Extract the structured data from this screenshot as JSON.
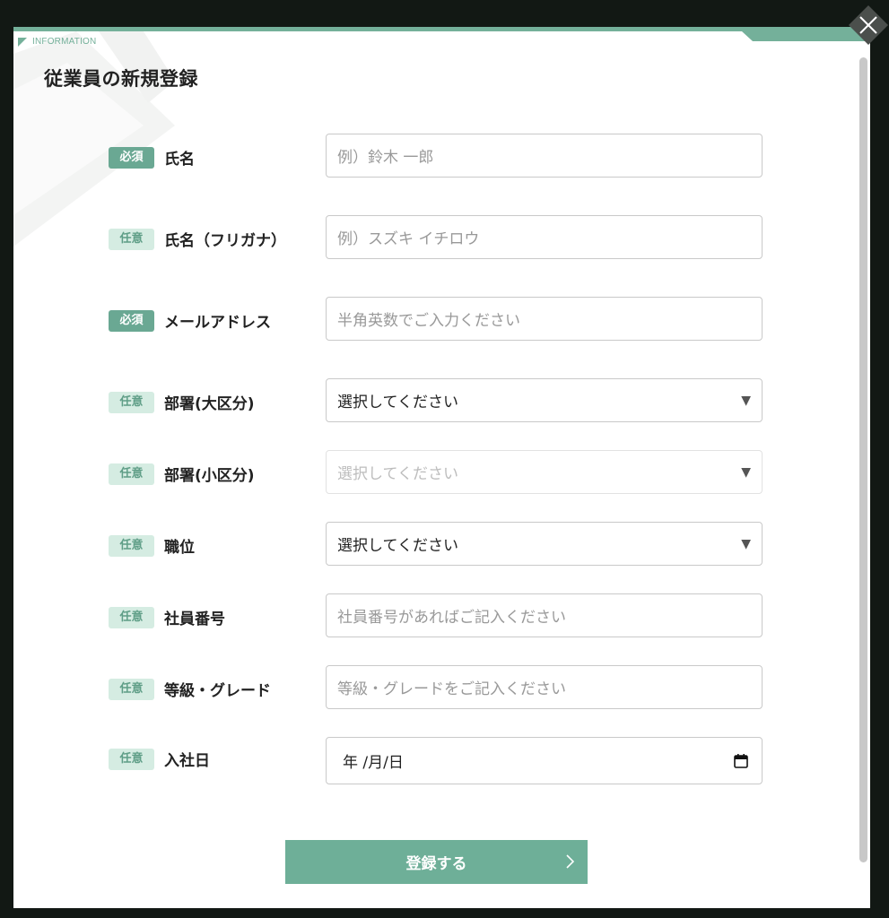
{
  "modal": {
    "info_label": "INFORMATION",
    "title": "従業員の新規登録",
    "submit_label": "登録する"
  },
  "badges": {
    "required": "必須",
    "optional": "任意"
  },
  "fields": [
    {
      "label": "氏名",
      "badge": "必須",
      "type": "text",
      "placeholder": "例）鈴木 一郎"
    },
    {
      "label": "氏名（フリガナ）",
      "badge": "任意",
      "type": "text",
      "placeholder": "例）スズキ イチロウ"
    },
    {
      "label": "メールアドレス",
      "badge": "必須",
      "type": "text",
      "placeholder": "半角英数でご入力ください"
    },
    {
      "label": "部署(大区分)",
      "badge": "任意",
      "type": "select",
      "value": "選択してください"
    },
    {
      "label": "部署(小区分)",
      "badge": "任意",
      "type": "select",
      "value": "選択してください",
      "disabled": true
    },
    {
      "label": "職位",
      "badge": "任意",
      "type": "select",
      "value": "選択してください"
    },
    {
      "label": "社員番号",
      "badge": "任意",
      "type": "text",
      "placeholder": "社員番号があればご記入ください"
    },
    {
      "label": "等級・グレード",
      "badge": "任意",
      "type": "text",
      "placeholder": "等級・グレードをご記入ください"
    },
    {
      "label": "入社日",
      "badge": "任意",
      "type": "date",
      "value": "年 /月/日"
    }
  ],
  "icons": {
    "close": "close-icon",
    "caret": "caret-down-icon",
    "calendar": "calendar-icon",
    "chevron": "chevron-right-icon"
  },
  "colors": {
    "accent": "#6eaf98",
    "badge_required": "#6aa893",
    "badge_optional_bg": "#d5ece2",
    "badge_optional_text": "#5f9e87",
    "overlay": "#121814"
  }
}
